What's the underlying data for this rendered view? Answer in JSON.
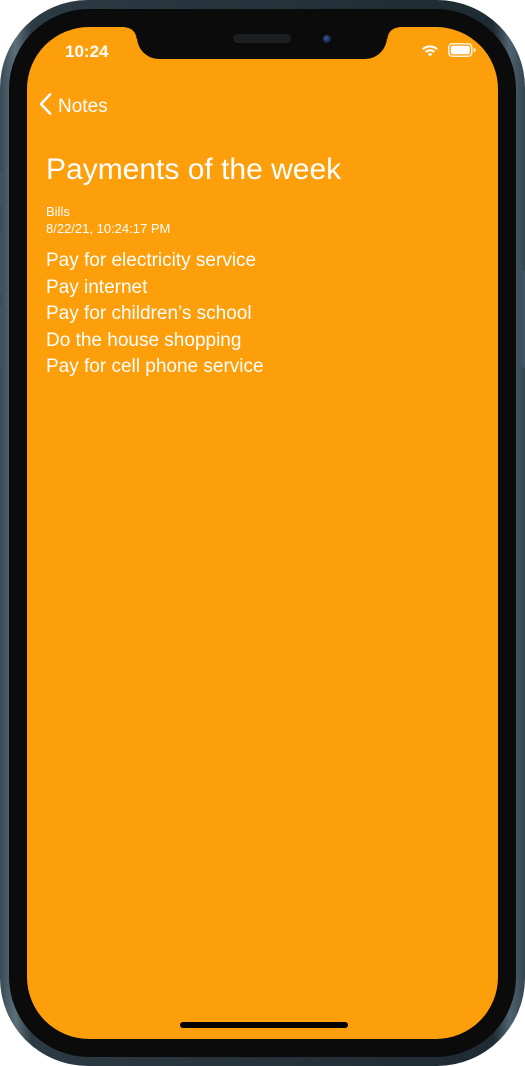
{
  "status_bar": {
    "time": "10:24",
    "icons": [
      "wifi-icon",
      "battery-icon"
    ]
  },
  "nav": {
    "back_label": "Notes",
    "back_icon": "chevron-left-icon"
  },
  "note": {
    "title": "Payments of the week",
    "category": "Bills",
    "date": "8/22/21, 10:24:17 PM",
    "lines": [
      "Pay for electricity service",
      "Pay internet",
      "Pay for children’s school",
      "Do the house shopping",
      "Pay for cell phone service"
    ]
  },
  "colors": {
    "note_background": "#fd9e0b",
    "text": "#ffffff"
  }
}
